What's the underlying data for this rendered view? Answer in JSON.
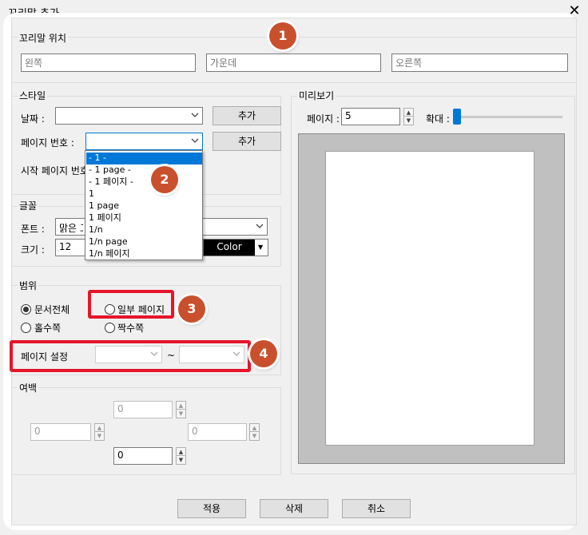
{
  "window": {
    "title": "꼬리말 추가",
    "close_glyph": "✕"
  },
  "position": {
    "label": "꼬리말 위치",
    "left_placeholder": "왼쪽",
    "center_placeholder": "가운데",
    "right_placeholder": "오른쪽"
  },
  "style": {
    "label": "스타일",
    "date_label": "날짜 :",
    "date_add": "추가",
    "page_number_label": "페이지 번호 :",
    "page_number_add": "추가",
    "start_page_label": "시작 페이지 번호",
    "page_number_options": [
      "- 1 -",
      "- 1 page -",
      "- 1 페이지 -",
      "1",
      "1 page",
      "1 페이지",
      "1/n",
      "1/n page",
      "1/n 페이지"
    ]
  },
  "font": {
    "label": "글꼴",
    "font_label": "폰트 :",
    "font_value": "맑은 고딕",
    "size_label": "크기 :",
    "size_value": "12",
    "color_label": "Color",
    "color_value": "#000000"
  },
  "range": {
    "label": "범위",
    "whole_document": "문서전체",
    "some_pages": "일부 페이지",
    "odd_pages": "홀수쪽",
    "even_pages": "짝수쪽",
    "page_setting_label": "페이지 설정",
    "tilde": "~"
  },
  "margin": {
    "label": "여백",
    "top": "0",
    "left": "0",
    "right": "0",
    "bottom": "0"
  },
  "preview": {
    "label": "미리보기",
    "page_label": "페이지 :",
    "page_value": "5",
    "zoom_label": "확대 :",
    "zoom_value": 0
  },
  "buttons": {
    "apply": "적용",
    "delete": "삭제",
    "cancel": "취소"
  },
  "annotations": {
    "badge1": "1",
    "badge2": "2",
    "badge3": "3",
    "badge4": "4",
    "accent": "#c9502d",
    "highlight": "#e5152a"
  }
}
